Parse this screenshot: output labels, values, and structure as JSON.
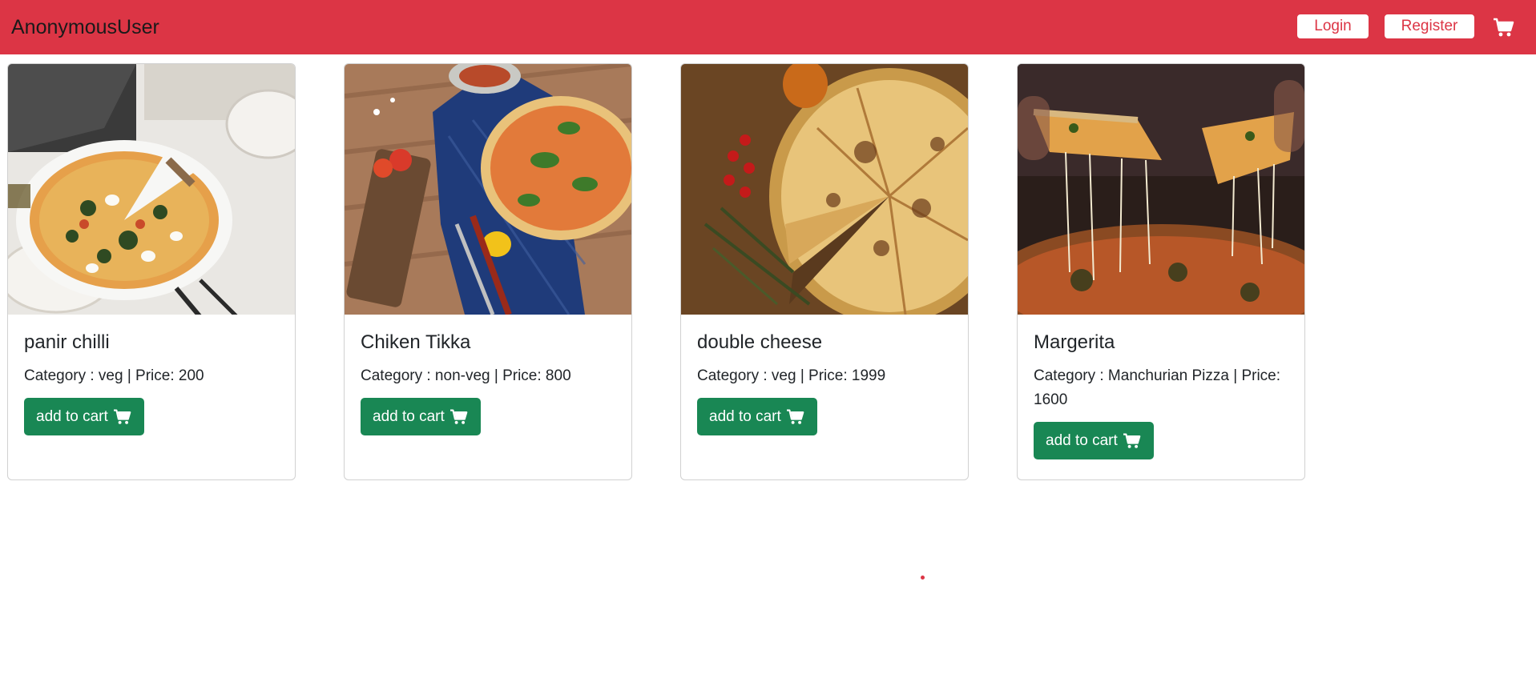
{
  "navbar": {
    "brand": "AnonymousUser",
    "login_label": "Login",
    "register_label": "Register",
    "cart_icon": "cart-icon",
    "background": "#dc3545"
  },
  "products": [
    {
      "name": "panir chilli",
      "info": "Category : veg | Price: 200",
      "button": "add to cart"
    },
    {
      "name": "Chiken Tikka",
      "info": "Category : non-veg | Price: 800",
      "button": "add to cart"
    },
    {
      "name": "double cheese",
      "info": "Category : veg | Price: 1999",
      "button": "add to cart"
    },
    {
      "name": "Margerita",
      "info": "Category : Manchurian Pizza | Price: 1600",
      "button": "add to cart"
    }
  ],
  "colors": {
    "accent": "#dc3545",
    "button": "#198754"
  }
}
